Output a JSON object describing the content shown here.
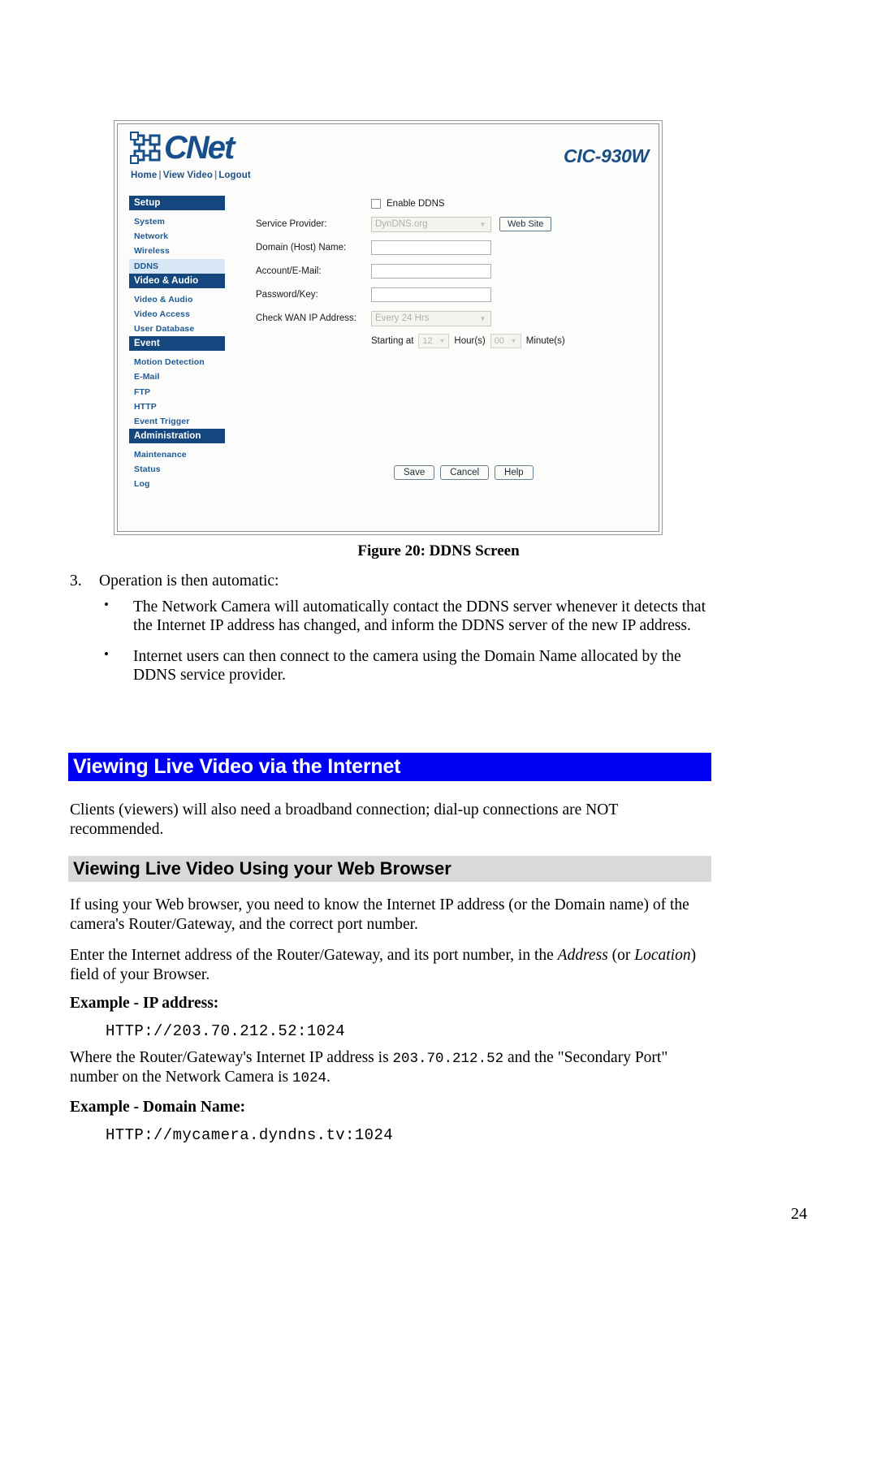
{
  "figure": {
    "brand": "CNet",
    "model": "CIC-930W",
    "nav": {
      "home": "Home",
      "view_video": "View Video",
      "logout": "Logout",
      "separator": "|"
    },
    "sidebar": [
      {
        "label": "Setup",
        "type": "header"
      },
      {
        "label": "System",
        "type": "item",
        "active": false
      },
      {
        "label": "Network",
        "type": "item",
        "active": false
      },
      {
        "label": "Wireless",
        "type": "item",
        "active": false
      },
      {
        "label": "DDNS",
        "type": "item",
        "active": true
      },
      {
        "label": "Video & Audio",
        "type": "header"
      },
      {
        "label": "Video & Audio",
        "type": "item",
        "active": false
      },
      {
        "label": "Video Access",
        "type": "item",
        "active": false
      },
      {
        "label": "User Database",
        "type": "item",
        "active": false
      },
      {
        "label": "Event",
        "type": "header"
      },
      {
        "label": "Motion Detection",
        "type": "item",
        "active": false
      },
      {
        "label": "E-Mail",
        "type": "item",
        "active": false
      },
      {
        "label": "FTP",
        "type": "item",
        "active": false
      },
      {
        "label": "HTTP",
        "type": "item",
        "active": false
      },
      {
        "label": "Event Trigger",
        "type": "item",
        "active": false
      },
      {
        "label": "Administration",
        "type": "header"
      },
      {
        "label": "Maintenance",
        "type": "item",
        "active": false
      },
      {
        "label": "Status",
        "type": "item",
        "active": false
      },
      {
        "label": "Log",
        "type": "item",
        "active": false
      }
    ],
    "form": {
      "enable_ddns_label": "Enable DDNS",
      "enable_ddns_checked": false,
      "service_provider_label": "Service Provider:",
      "service_provider_value": "DynDNS.org",
      "web_site_button": "Web Site",
      "domain_label": "Domain (Host) Name:",
      "domain_value": "",
      "account_label": "Account/E-Mail:",
      "account_value": "",
      "password_label": "Password/Key:",
      "password_value": "",
      "check_wan_label": "Check WAN IP Address:",
      "check_wan_value": "Every 24 Hrs",
      "starting_at_label": "Starting at",
      "hour_value": "12",
      "hour_unit": "Hour(s)",
      "minute_value": "00",
      "minute_unit": "Minute(s)"
    },
    "buttons": {
      "save": "Save",
      "cancel": "Cancel",
      "help": "Help"
    }
  },
  "caption": "Figure 20: DDNS Screen",
  "steps": {
    "number": "3.",
    "text": "Operation is then automatic:",
    "bullets": [
      "The Network Camera will automatically contact the DDNS server whenever it detects that the Internet IP address has changed, and inform the DDNS server of the new IP address.",
      "Internet users can then connect to the camera using the Domain Name allocated by the DDNS service provider."
    ]
  },
  "section_heading": "Viewing Live Video via the Internet",
  "intro_paragraph": "Clients (viewers) will also need a broadband connection; dial-up connections are NOT recommended.",
  "subsection_heading": "Viewing Live Video Using your Web Browser",
  "paragraph_1": "If using your Web browser, you need to know the Internet IP address (or the Domain name) of the camera's Router/Gateway, and the correct port number.",
  "paragraph_2_a": "Enter the Internet address of the Router/Gateway, and its port number, in the ",
  "paragraph_2_italic_1": "Address",
  "paragraph_2_b": " (or ",
  "paragraph_2_italic_2": "Location",
  "paragraph_2_c": ") field of your Browser.",
  "example_ip_heading": "Example - IP address:",
  "example_ip_value": "HTTP://203.70.212.52:1024",
  "where_a": "Where the Router/Gateway's Internet IP address is ",
  "where_ip": "203.70.212.52",
  "where_b": " and the \"Secondary Port\" number on the Network Camera is ",
  "where_port": "1024",
  "where_c": ".",
  "example_domain_heading": "Example - Domain Name:",
  "example_domain_value": "HTTP://mycamera.dyndns.tv:1024",
  "page_number": "24",
  "colors": {
    "brand_blue": "#164f8c",
    "sidebar_header": "#15477f",
    "sidebar_active": "#d7e7f6",
    "band_blue": "#0000f5",
    "band_grey": "#d9d9d9"
  }
}
